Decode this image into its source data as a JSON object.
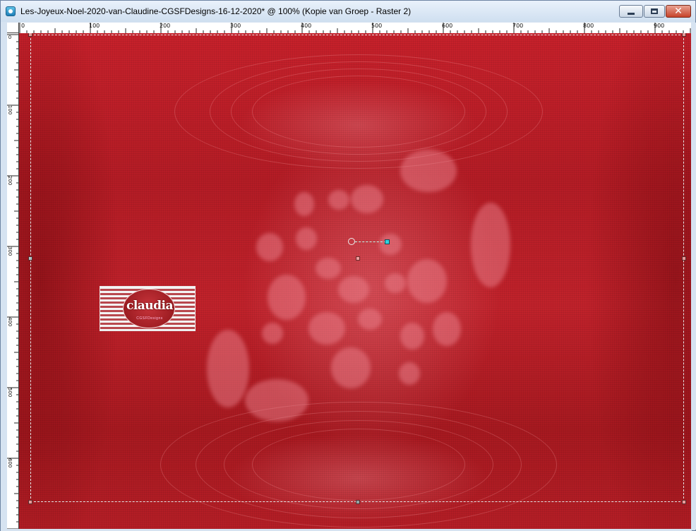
{
  "window": {
    "title": "Les-Joyeux-Noel-2020-van-Claudine-CGSFDesigns-16-12-2020* @ 100% (Kopie van Groep - Raster 2)",
    "icon": "psp-app-icon",
    "controls": {
      "minimize_icon": "minimize-icon",
      "maximize_icon": "maximize-icon",
      "close_glyph": "✕"
    }
  },
  "ruler": {
    "top_labels": [
      "0",
      "100",
      "200",
      "300",
      "400",
      "500",
      "600",
      "700",
      "800",
      "900"
    ],
    "left_labels": [
      "0",
      "100",
      "200",
      "300",
      "400",
      "500",
      "600"
    ]
  },
  "canvas": {
    "background_color": "#c0202a",
    "watermark": {
      "brand": "claudia",
      "subtitle": "CGSFDesigns"
    }
  },
  "colors": {
    "titlebar": "#d6e3f1",
    "close_button": "#c7432a",
    "rotation_handle": "#33d0e0",
    "node_handle": "#e89a9a"
  }
}
